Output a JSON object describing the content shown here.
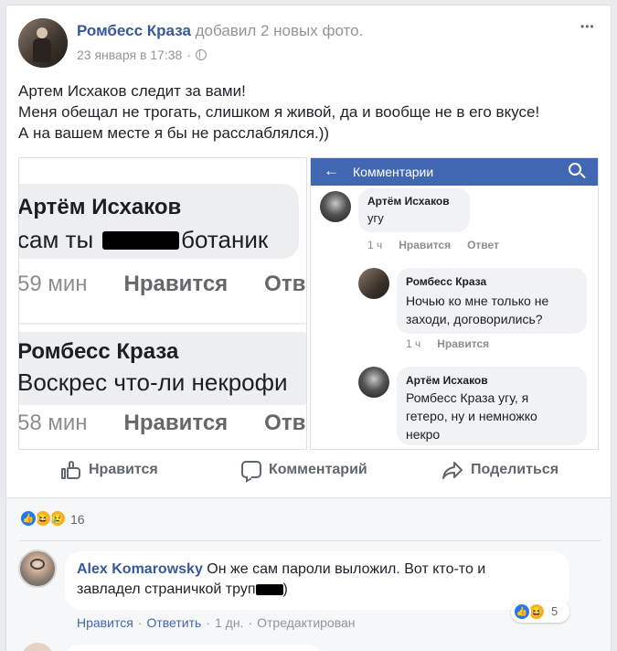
{
  "post": {
    "author": "Ромбесс Краза",
    "action": "добавил 2 новых фото.",
    "date": "23 января в 17:38",
    "dot": "·",
    "privacy_icon": "globe-icon",
    "menu": "•••",
    "text_line1": "Артем Исхаков следит за вами!",
    "text_line2": "Меня обещал не трогать, слишком я живой, да и вообще не в его вкусе!",
    "text_line3": "А на вашем месте я бы не расслаблялся.))"
  },
  "photo1": {
    "name1": "Артём Исхаков",
    "msg1_a": "сам ты",
    "msg1_b": "ботаник",
    "time1": "59 мин",
    "like1": "Нравится",
    "reply1": "Отве",
    "name2": "Ромбесс Краза",
    "msg2": "Воскрес что-ли некрофи",
    "time2": "58 мин",
    "like2": "Нравится",
    "reply2": "Отве"
  },
  "photo2": {
    "header": "Комментарии",
    "c1_name": "Артём Исхаков",
    "c1_text": "угу",
    "c1_time": "1 ч",
    "c1_like": "Нравится",
    "c1_reply": "Ответ",
    "c2_name": "Ромбесс Краза",
    "c2_line1": "Ночью ко мне только не",
    "c2_line2": "заходи, договорились?",
    "c2_time": "1 ч",
    "c2_like": "Нравится",
    "c3_name": "Артём Исхаков",
    "c3_line1": "Ромбесс Краза угу, я",
    "c3_line2": "гетеро, ну и немножко",
    "c3_line3": "некро"
  },
  "actions": {
    "like": "Нравится",
    "comment": "Комментарий",
    "share": "Поделиться"
  },
  "reactions": {
    "count": "16"
  },
  "comment": {
    "author": "Alex Komarowsky",
    "line1": "Он же сам пароли выложил. Вот кто-то и",
    "line2_a": "завладел страничкой труп",
    "line2_b": ")",
    "reaction_count": "5",
    "like": "Нравится",
    "reply": "Ответить",
    "time": "1 дн.",
    "edited": "Отредактирован",
    "sep": "·"
  },
  "colors": {
    "facebook_blue": "#4267b2",
    "link": "#385898",
    "like_blue": "#2078f4",
    "haha_yellow": "#f7b125"
  }
}
